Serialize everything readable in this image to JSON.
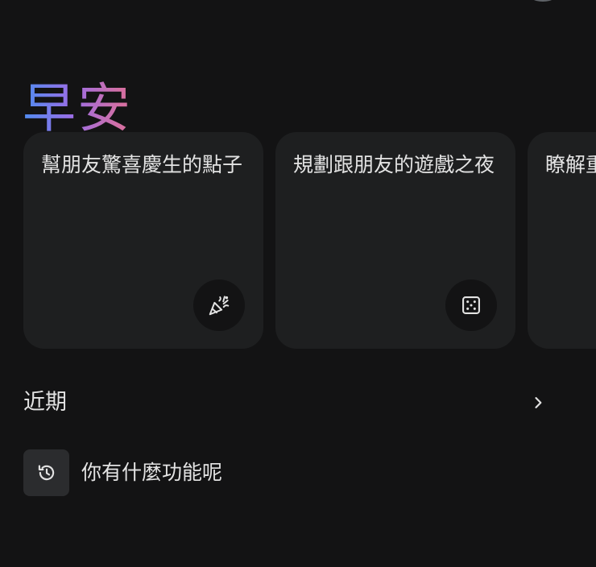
{
  "greeting": "早安",
  "suggestions": [
    {
      "text": "幫朋友驚喜慶生的點子",
      "icon": "party-popper-icon"
    },
    {
      "text": "規劃跟朋友的遊戲之夜",
      "icon": "dice-icon"
    },
    {
      "text": "瞭解重",
      "icon": ""
    }
  ],
  "recent": {
    "title": "近期",
    "more_icon": "chevron-right-icon",
    "items": [
      {
        "label": "你有什麼功能呢",
        "icon": "history-icon"
      }
    ]
  },
  "colors": {
    "background": "#131314",
    "card": "#1e1f20",
    "text": "#e3e3e3",
    "greeting_gradient": [
      "#4f8cf0",
      "#9a6ee6",
      "#d56fa2"
    ]
  }
}
